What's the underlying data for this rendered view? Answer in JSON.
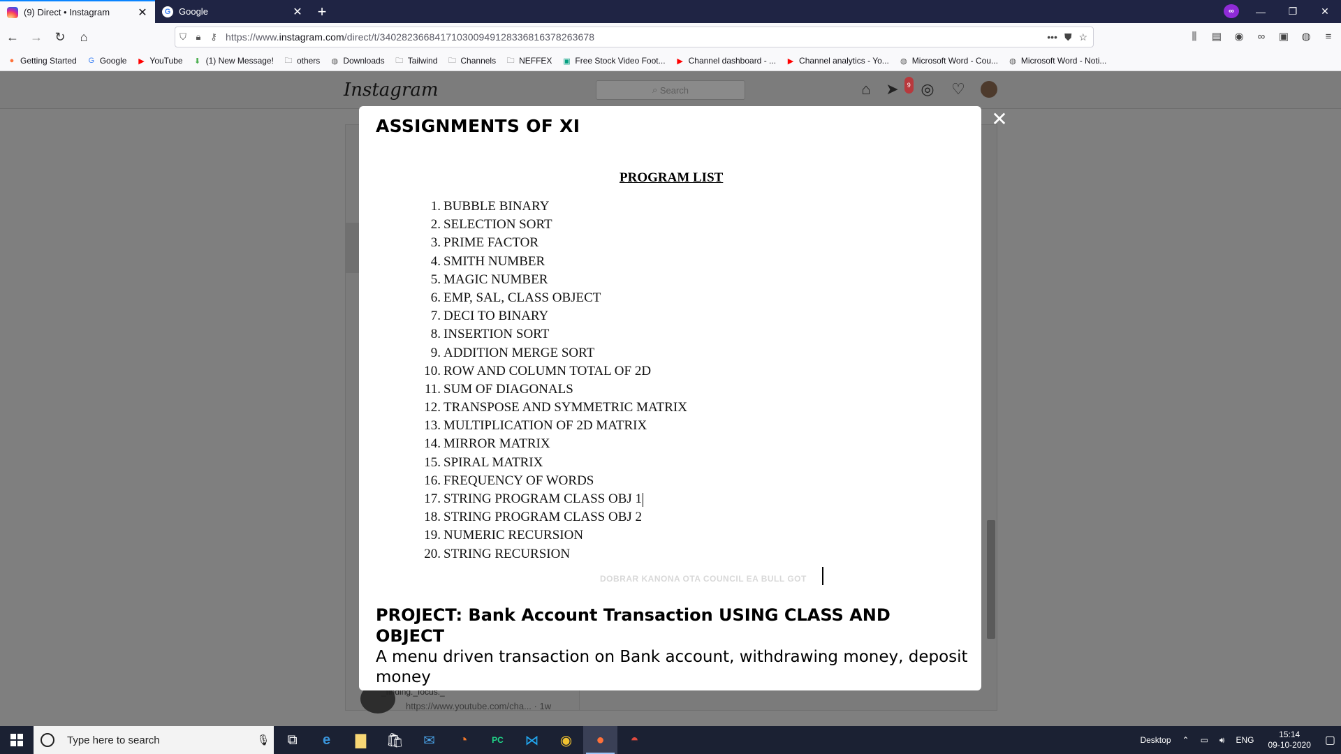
{
  "browser": {
    "tabs": [
      {
        "title": "(9) Direct • Instagram",
        "active": true
      },
      {
        "title": "Google",
        "active": false
      }
    ],
    "url_prefix": "https://www.",
    "url_domain": "instagram.com",
    "url_path": "/direct/t/340282366841710300949128336816378263678",
    "bookmarks": [
      {
        "label": "Getting Started",
        "icon": "firefox-icon"
      },
      {
        "label": "Google",
        "icon": "google-icon"
      },
      {
        "label": "YouTube",
        "icon": "youtube-icon"
      },
      {
        "label": "(1) New Message!",
        "icon": "download-arrow-icon"
      },
      {
        "label": "others",
        "icon": "folder-icon"
      },
      {
        "label": "Downloads",
        "icon": "globe-icon"
      },
      {
        "label": "Tailwind",
        "icon": "folder-icon"
      },
      {
        "label": "Channels",
        "icon": "folder-icon"
      },
      {
        "label": "NEFFEX",
        "icon": "folder-icon"
      },
      {
        "label": "Free Stock Video Foot...",
        "icon": "pexels-icon"
      },
      {
        "label": "Channel dashboard - ...",
        "icon": "youtube-icon"
      },
      {
        "label": "Channel analytics - Yo...",
        "icon": "youtube-icon"
      },
      {
        "label": "Microsoft Word - Cou...",
        "icon": "globe-icon"
      },
      {
        "label": "Microsoft Word - Noti...",
        "icon": "globe-icon"
      }
    ]
  },
  "instagram": {
    "logo": "Instagram",
    "search_placeholder": "Search",
    "notification_count": "9",
    "bottom_username": "_finding._focus._",
    "bottom_link": "https://www.youtube.com/cha... · 1w"
  },
  "document": {
    "title": "ASSIGNMENTS OF XI",
    "list_heading": "PROGRAM LIST",
    "programs": [
      {
        "num": "1.",
        "name": "BUBBLE BINARY"
      },
      {
        "num": "2.",
        "name": "SELECTION SORT"
      },
      {
        "num": "3.",
        "name": "PRIME FACTOR"
      },
      {
        "num": "4.",
        "name": "SMITH NUMBER"
      },
      {
        "num": "5.",
        "name": "MAGIC NUMBER"
      },
      {
        "num": "6.",
        "name": "EMP, SAL, CLASS OBJECT"
      },
      {
        "num": "7.",
        "name": "DECI TO BINARY"
      },
      {
        "num": "8.",
        "name": "INSERTION SORT"
      },
      {
        "num": "9.",
        "name": "ADDITION MERGE SORT"
      },
      {
        "num": "10.",
        "name": "ROW AND COLUMN TOTAL OF 2D"
      },
      {
        "num": "11.",
        "name": "SUM OF DIAGONALS"
      },
      {
        "num": "12.",
        "name": "TRANSPOSE AND SYMMETRIC MATRIX"
      },
      {
        "num": "13.",
        "name": "MULTIPLICATION OF 2D MATRIX"
      },
      {
        "num": "14.",
        "name": "MIRROR MATRIX"
      },
      {
        "num": "15.",
        "name": "SPIRAL MATRIX"
      },
      {
        "num": "16.",
        "name": "FREQUENCY OF WORDS"
      },
      {
        "num": "17.",
        "name": "STRING PROGRAM CLASS OBJ 1"
      },
      {
        "num": "18.",
        "name": "STRING PROGRAM CLASS OBJ 2"
      },
      {
        "num": "19.",
        "name": "NUMERIC RECURSION"
      },
      {
        "num": "20.",
        "name": "STRING RECURSION"
      }
    ],
    "ghost_text": "DOBRAR KANONA OTA COUNCIL EA BULL GOT",
    "project_title": "PROJECT: Bank Account Transaction USING CLASS AND OBJECT",
    "project_desc": "A menu driven transaction on Bank account, withdrawing money, deposit money"
  },
  "taskbar": {
    "search_placeholder": "Type here to search",
    "desktop_label": "Desktop",
    "language": "ENG",
    "time": "15:14",
    "date": "09-10-2020"
  }
}
